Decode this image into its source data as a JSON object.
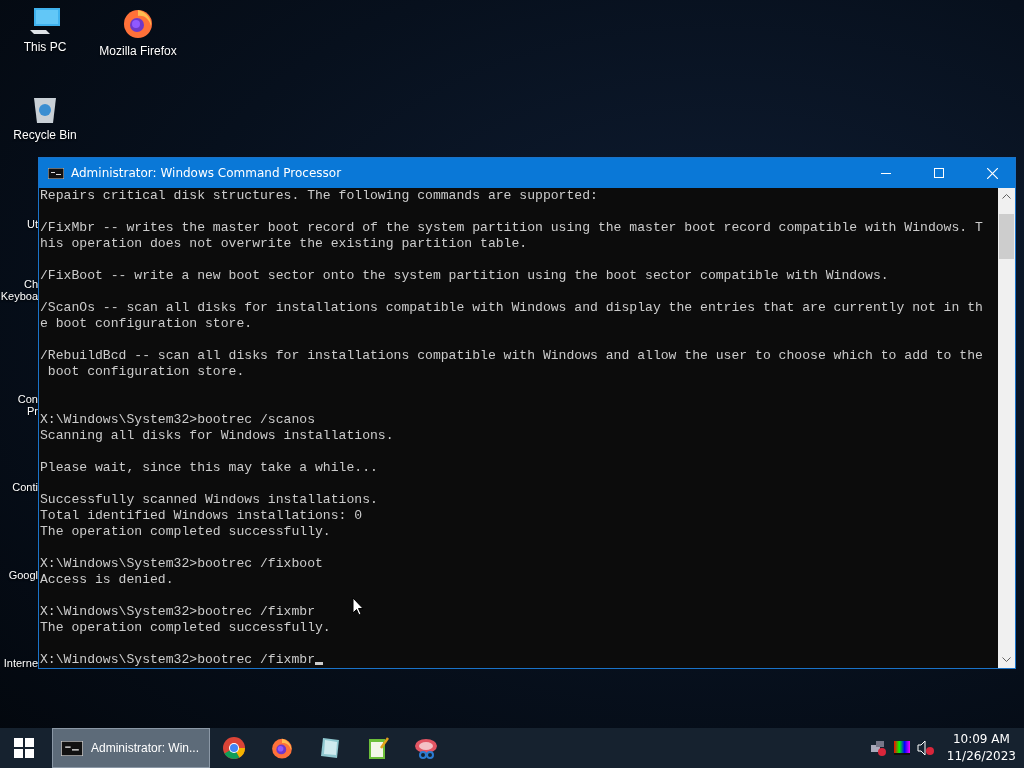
{
  "desktop_icons": [
    {
      "kind": "pc",
      "label": "This PC"
    },
    {
      "kind": "firefox",
      "label": "Mozilla Firefox"
    },
    {
      "kind": "bin",
      "label": "Recycle Bin"
    }
  ],
  "covered_labels": [
    {
      "lines": [
        "Ut"
      ]
    },
    {
      "lines": [
        "Ch",
        "Keyboa"
      ]
    },
    {
      "lines": [
        "Con",
        "Pr"
      ]
    },
    {
      "lines": [
        "Conti"
      ]
    },
    {
      "lines": [
        "Googl"
      ]
    },
    {
      "lines": [
        "Interne"
      ]
    }
  ],
  "window": {
    "title": "Administrator: Windows Command Processor",
    "console": [
      {
        "spaced": false,
        "lines": [
          "Repairs critical disk structures. The following commands are supported:"
        ]
      },
      {
        "spaced": false,
        "lines": [
          "/FixMbr -- writes the master boot record of the system partition using the master boot record compatible with Windows. T",
          "his operation does not overwrite the existing partition table."
        ]
      },
      {
        "spaced": false,
        "lines": [
          "/FixBoot -- write a new boot sector onto the system partition using the boot sector compatible with Windows."
        ]
      },
      {
        "spaced": false,
        "lines": [
          "/ScanOs -- scan all disks for installations compatible with Windows and display the entries that are currently not in th",
          "e boot configuration store."
        ]
      },
      {
        "spaced": false,
        "lines": [
          "/RebuildBcd -- scan all disks for installations compatible with Windows and allow the user to choose which to add to the",
          " boot configuration store."
        ]
      },
      {
        "spaced": true,
        "lines": [
          "X:\\Windows\\System32>bootrec /scanos",
          "Scanning all disks for Windows installations."
        ]
      },
      {
        "spaced": false,
        "lines": [
          "Please wait, since this may take a while..."
        ]
      },
      {
        "spaced": false,
        "lines": [
          "Successfully scanned Windows installations.",
          "Total identified Windows installations: 0",
          "The operation completed successfully."
        ]
      },
      {
        "spaced": false,
        "lines": [
          "X:\\Windows\\System32>bootrec /fixboot",
          "Access is denied."
        ]
      },
      {
        "spaced": false,
        "lines": [
          "X:\\Windows\\System32>bootrec /fixmbr",
          "The operation completed successfully."
        ]
      },
      {
        "spaced": false,
        "lines": [
          "X:\\Windows\\System32>bootrec /fixmbr"
        ]
      }
    ]
  },
  "taskbar": {
    "task": {
      "label": "Administrator: Win...",
      "selected": true
    },
    "pinned": [
      {
        "kind": "chrome"
      },
      {
        "kind": "firefox"
      },
      {
        "kind": "notepad"
      },
      {
        "kind": "editor"
      },
      {
        "kind": "snip"
      }
    ],
    "tray": {
      "time": "10:09 AM",
      "date": "11/26/2023"
    }
  }
}
